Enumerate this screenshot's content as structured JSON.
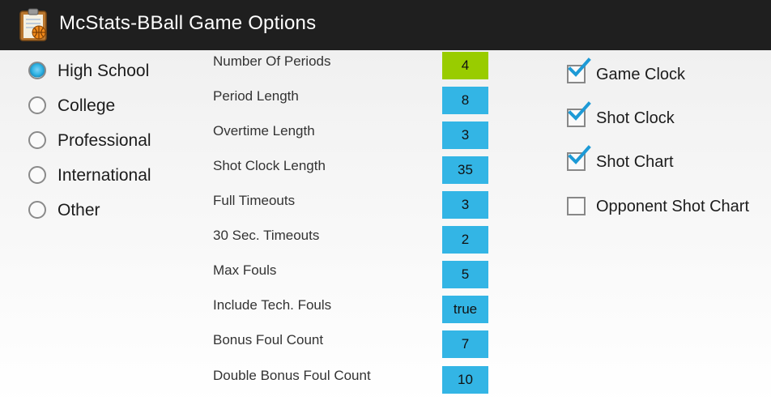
{
  "header": {
    "title": "McStats-BBall Game Options",
    "icon": "clipboard-basketball-icon"
  },
  "level": {
    "selected": "High School",
    "options": [
      {
        "label": "High School",
        "checked": true
      },
      {
        "label": "College",
        "checked": false
      },
      {
        "label": "Professional",
        "checked": false
      },
      {
        "label": "International",
        "checked": false
      },
      {
        "label": "Other",
        "checked": false
      }
    ]
  },
  "settings": [
    {
      "label": "Number Of Periods",
      "value": "4",
      "active": true
    },
    {
      "label": "Period Length",
      "value": "8",
      "active": false
    },
    {
      "label": "Overtime Length",
      "value": "3",
      "active": false
    },
    {
      "label": "Shot Clock Length",
      "value": "35",
      "active": false
    },
    {
      "label": "Full Timeouts",
      "value": "3",
      "active": false
    },
    {
      "label": "30 Sec. Timeouts",
      "value": "2",
      "active": false
    },
    {
      "label": "Max Fouls",
      "value": "5",
      "active": false
    },
    {
      "label": "Include Tech. Fouls",
      "value": "true",
      "active": false
    },
    {
      "label": "Bonus Foul Count",
      "value": "7",
      "active": false
    },
    {
      "label": "Double Bonus Foul Count",
      "value": "10",
      "active": false
    }
  ],
  "features": [
    {
      "label": "Game Clock",
      "checked": true
    },
    {
      "label": "Shot Clock",
      "checked": true
    },
    {
      "label": "Shot Chart",
      "checked": true
    },
    {
      "label": "Opponent Shot Chart",
      "checked": false
    }
  ],
  "colors": {
    "titlebar": "#1f1f1f",
    "accent_blue": "#33b5e5",
    "accent_green": "#99cc00",
    "check_blue": "#1d9ad6"
  }
}
